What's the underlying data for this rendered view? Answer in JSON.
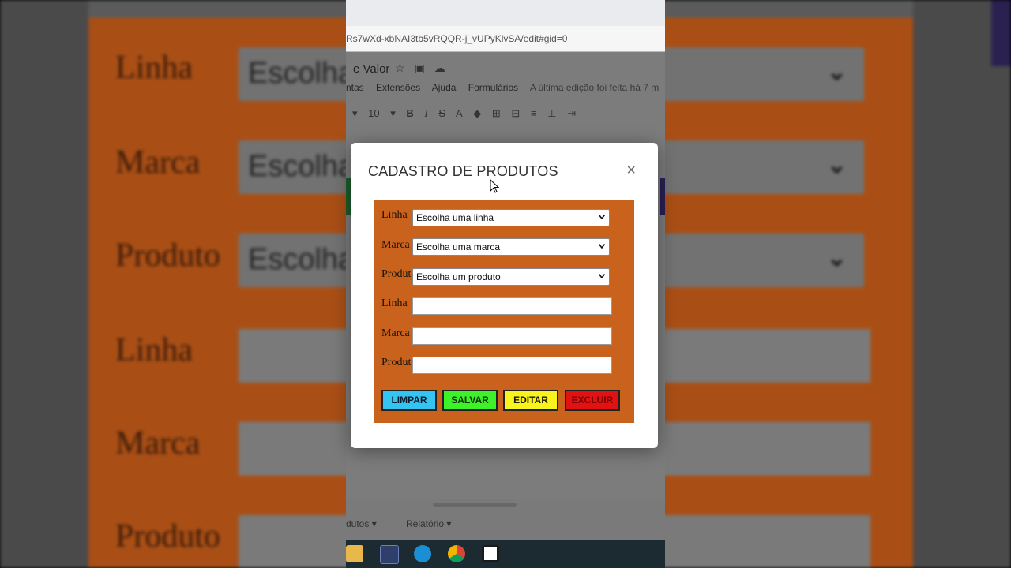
{
  "background": {
    "labels": [
      "Linha",
      "Marca",
      "Produto",
      "Linha",
      "Marca",
      "Produto"
    ],
    "select_text": "Escolha"
  },
  "browser": {
    "url": "Rs7wXd-xbNAI3tb5vRQQR-j_vUPyKlvSA/edit#gid=0"
  },
  "sheets": {
    "doc_title": "e Valor",
    "menu": [
      "ntas",
      "Extensões",
      "Ajuda",
      "Formulários"
    ],
    "last_edit": "A última edição foi feita há 7 m",
    "font_size": "10",
    "tabs": [
      "dutos",
      "Relatório"
    ]
  },
  "modal": {
    "title": "CADASTRO DE PRODUTOS",
    "close_label": "×",
    "rows": [
      {
        "label": "Linha",
        "value": "Escolha uma linha"
      },
      {
        "label": "Marca",
        "value": "Escolha uma marca"
      },
      {
        "label": "Produto",
        "value": "Escolha um produto"
      },
      {
        "label": "Linha",
        "value": ""
      },
      {
        "label": "Marca",
        "value": ""
      },
      {
        "label": "Produto",
        "value": ""
      }
    ],
    "buttons": {
      "limpar": "LIMPAR",
      "salvar": "SALVAR",
      "editar": "EDITAR",
      "excluir": "EXCLUIR"
    }
  },
  "colors": {
    "form_bg": "#c8621d",
    "limpar": "#33c4f2",
    "salvar": "#3ef229",
    "editar": "#f8f21e",
    "excluir": "#e01212"
  }
}
